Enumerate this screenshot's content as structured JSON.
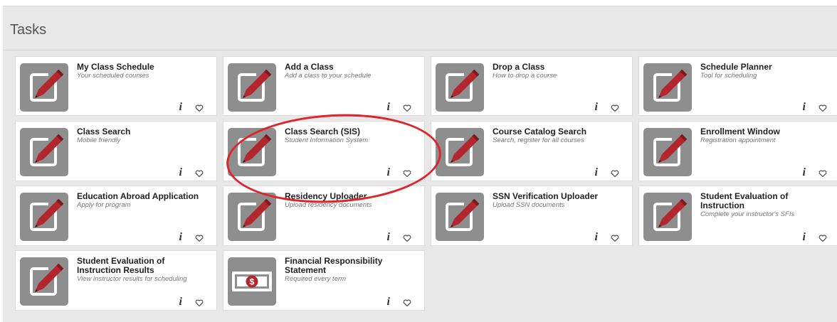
{
  "panel": {
    "title": "Tasks"
  },
  "tiles": [
    {
      "title": "My Class Schedule",
      "desc": "Your scheduled courses",
      "icon": "pencil-edit-icon"
    },
    {
      "title": "Add a Class",
      "desc": "Add a class to your schedule",
      "icon": "pencil-edit-icon"
    },
    {
      "title": "Drop a Class",
      "desc": "How to drop a course",
      "icon": "pencil-edit-icon"
    },
    {
      "title": "Schedule Planner",
      "desc": "Tool for scheduling",
      "icon": "pencil-edit-icon"
    },
    {
      "title": "Class Search",
      "desc": "Mobile friendly",
      "icon": "pencil-edit-icon"
    },
    {
      "title": "Class Search (SIS)",
      "desc": "Student Information System",
      "icon": "pencil-edit-icon"
    },
    {
      "title": "Course Catalog Search",
      "desc": "Search, register for all courses",
      "icon": "pencil-edit-icon"
    },
    {
      "title": "Enrollment Window",
      "desc": "Registration appointment",
      "icon": "pencil-edit-icon"
    },
    {
      "title": "Education Abroad Application",
      "desc": "Apply for program",
      "icon": "pencil-edit-icon"
    },
    {
      "title": "Residency Uploader",
      "desc": "Upload residency documents",
      "icon": "pencil-edit-icon"
    },
    {
      "title": "SSN Verification Uploader",
      "desc": "Upload SSN documents",
      "icon": "pencil-edit-icon"
    },
    {
      "title": "Student Evaluation of Instruction",
      "desc": "Complete your instructor's SFIs",
      "icon": "pencil-edit-icon"
    },
    {
      "title": "Student Evaluation of Instruction Results",
      "desc": "View instructor results for scheduling",
      "icon": "pencil-edit-icon"
    },
    {
      "title": "Financial Responsibility Statement",
      "desc": "Required every term",
      "icon": "dollar-bill-icon"
    }
  ],
  "info_glyph": "i",
  "colors": {
    "accent_red": "#b3262d",
    "icon_bg": "#8e8e8e",
    "highlight": "#e0242b"
  }
}
